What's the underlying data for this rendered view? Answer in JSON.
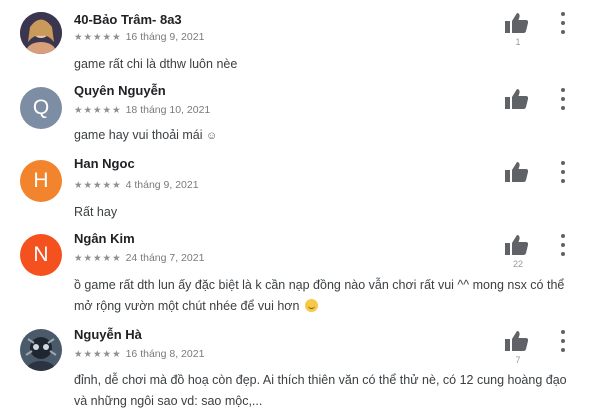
{
  "reviews": [
    {
      "author": "40-Bảo Trâm- 8a3",
      "stars": "★★★★★",
      "date": "16 tháng 9, 2021",
      "text": "game rất chi là dthw luôn nèe",
      "avatar_type": "image",
      "likes": "1"
    },
    {
      "author": "Quyên Nguyễn",
      "stars": "★★★★★",
      "date": "18 tháng 10, 2021",
      "text": "game hay vui thoải mái",
      "text_suffix": "☺",
      "avatar_letter": "Q",
      "avatar_color": "#7d8da3",
      "likes": ""
    },
    {
      "author": "Han Ngoc",
      "stars": "★★★★★",
      "date": "4 tháng 9, 2021",
      "text": "Rất hay",
      "avatar_letter": "H",
      "avatar_color": "#f2842d",
      "likes": ""
    },
    {
      "author": "Ngân Kim",
      "stars": "★★★★★",
      "date": "24 tháng 7, 2021",
      "text": "ồ game rất dth lun ấy đặc biệt là k cần nạp đồng nào vẫn chơi rất vui ^^ mong nsx có thể mở rộng vườn một chút nhée để vui hơn",
      "avatar_letter": "N",
      "avatar_color": "#f4511e",
      "likes": "22"
    },
    {
      "author": "Nguyễn Hà",
      "stars": "★★★★★",
      "date": "16 tháng 8, 2021",
      "text": "đỉnh, dễ chơi mà đồ hoạ còn đẹp. Ai thích thiên văn có thể thử nè, có 12 cung hoàng đạo và những ngôi sao vd: sao mộc,...",
      "avatar_type": "image",
      "likes": "7"
    }
  ],
  "icons": {
    "like": "thumbs-up-icon",
    "more": "more-vert-icon",
    "emoji": "smiling-face-icon"
  }
}
